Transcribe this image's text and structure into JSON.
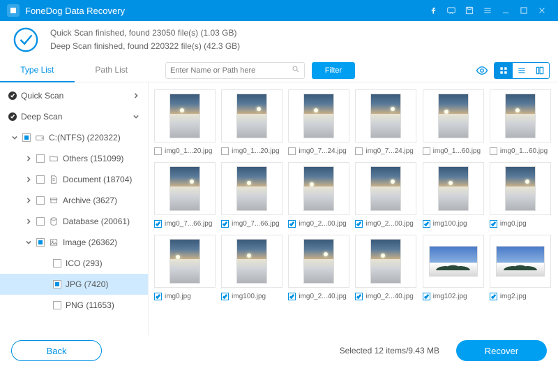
{
  "app": {
    "title": "FoneDog Data Recovery"
  },
  "status": {
    "line1": "Quick Scan finished, found 23050 file(s) (1.03 GB)",
    "line2": "Deep Scan finished, found 220322 file(s) (42.3 GB)"
  },
  "tabs": {
    "typelist": "Type List",
    "pathlist": "Path List"
  },
  "search": {
    "placeholder": "Enter Name or Path here"
  },
  "filter": {
    "label": "Filter"
  },
  "sidebar": {
    "quickscan": "Quick Scan",
    "deepscan": "Deep Scan",
    "drive": "C:(NTFS) (220322)",
    "others": "Others (151099)",
    "document": "Document (18704)",
    "archive": "Archive (3627)",
    "database": "Database (20061)",
    "image": "Image (26362)",
    "ico": "ICO (293)",
    "jpg": "JPG (7420)",
    "png": "PNG (11653)"
  },
  "grid": [
    {
      "name": "img0_1...20.jpg",
      "checked": false,
      "variant": "v1"
    },
    {
      "name": "img0_1...20.jpg",
      "checked": false,
      "variant": "v2"
    },
    {
      "name": "img0_7...24.jpg",
      "checked": false,
      "variant": "v1"
    },
    {
      "name": "img0_7...24.jpg",
      "checked": false,
      "variant": "v2"
    },
    {
      "name": "img0_1...60.jpg",
      "checked": false,
      "variant": "v3"
    },
    {
      "name": "img0_1...60.jpg",
      "checked": false,
      "variant": "v1"
    },
    {
      "name": "img0_7...66.jpg",
      "checked": true,
      "variant": "v2"
    },
    {
      "name": "img0_7...66.jpg",
      "checked": true,
      "variant": "v1"
    },
    {
      "name": "img0_2...00.jpg",
      "checked": true,
      "variant": "v3"
    },
    {
      "name": "img0_2...00.jpg",
      "checked": true,
      "variant": "v2"
    },
    {
      "name": "img100.jpg",
      "checked": true,
      "variant": "v1"
    },
    {
      "name": "img0.jpg",
      "checked": true,
      "variant": "v2"
    },
    {
      "name": "img0.jpg",
      "checked": true,
      "variant": "v3"
    },
    {
      "name": "img100.jpg",
      "checked": true,
      "variant": "v1"
    },
    {
      "name": "img0_2...40.jpg",
      "checked": true,
      "variant": "v2"
    },
    {
      "name": "img0_2...40.jpg",
      "checked": true,
      "variant": "v1"
    },
    {
      "name": "img102.jpg",
      "checked": true,
      "variant": "wide"
    },
    {
      "name": "img2.jpg",
      "checked": true,
      "variant": "wide"
    }
  ],
  "footer": {
    "back": "Back",
    "recover": "Recover",
    "selected": "Selected 12 items/9.43 MB"
  }
}
